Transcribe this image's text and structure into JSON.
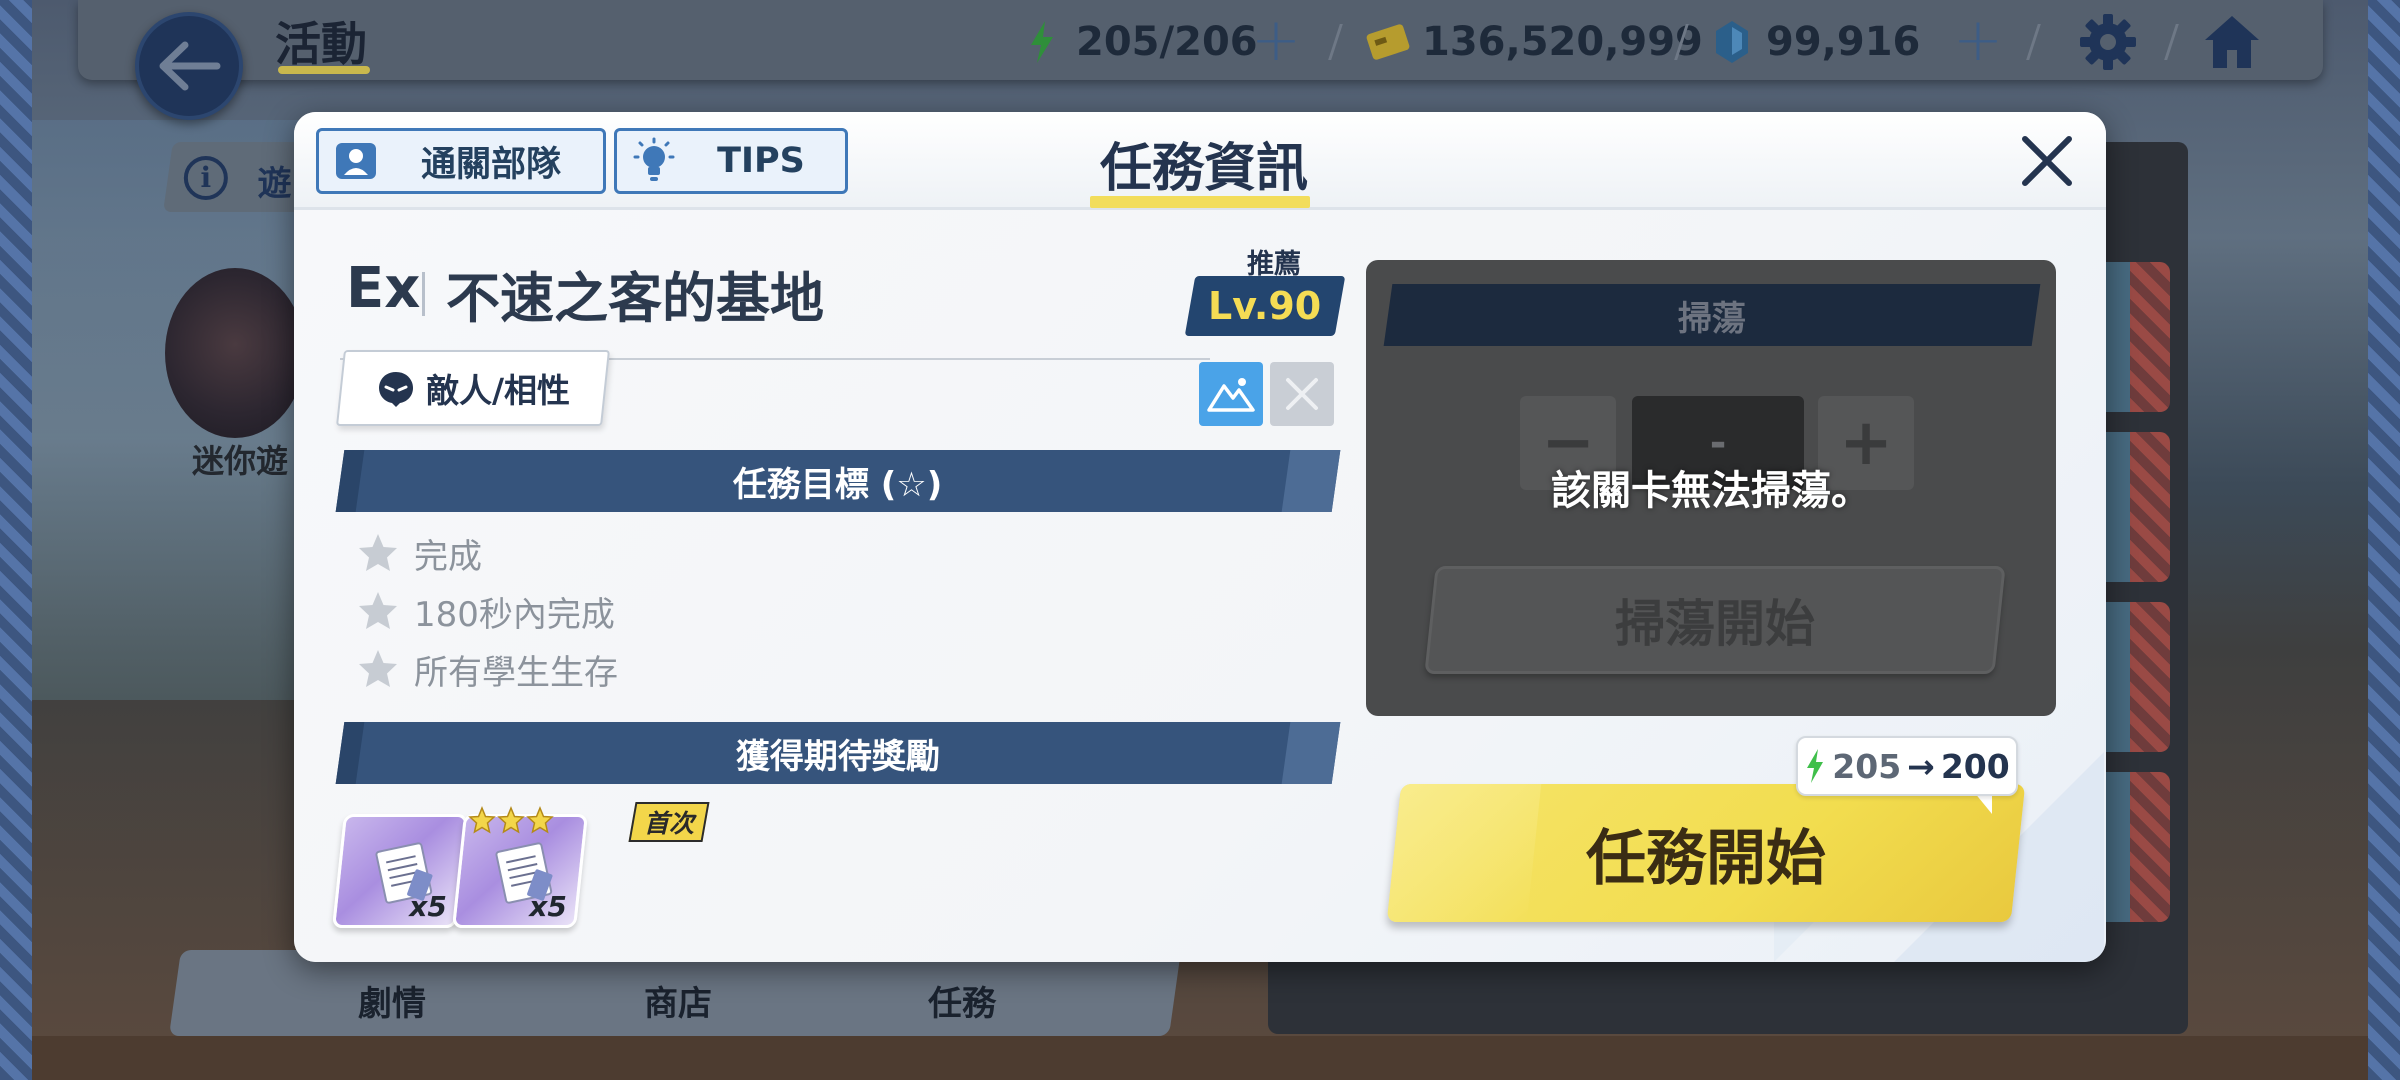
{
  "topbar": {
    "title": "活動",
    "stamina": "205/206",
    "credits": "136,520,999",
    "gems": "99,916"
  },
  "background": {
    "info_text": "遊",
    "mini_game_label": "迷你遊",
    "tabs": [
      "劇情",
      "商店",
      "任務"
    ]
  },
  "modal": {
    "title": "任務資訊",
    "header_buttons": {
      "clear_team": "通關部隊",
      "tips": "TIPS"
    },
    "stage": {
      "difficulty": "Ex",
      "name": "不速之客的基地",
      "recommend_label": "推薦",
      "recommend_level": "Lv.90"
    },
    "enemy_button": "敵人/相性",
    "objectives": {
      "header": "任務目標 (☆)",
      "items": [
        "完成",
        "180秒內完成",
        "所有學生生存"
      ]
    },
    "rewards": {
      "header": "獲得期待獎勵",
      "first_clear_tag": "首次",
      "items": [
        {
          "qty": "x5"
        },
        {
          "qty": "x5"
        }
      ]
    },
    "sweep": {
      "title": "掃蕩",
      "minus": "−",
      "value": "-",
      "plus": "+",
      "message": "該關卡無法掃蕩。",
      "start_label": "掃蕩開始"
    },
    "start": {
      "label": "任務開始",
      "cost_from": "205",
      "cost_arrow": "→",
      "cost_to": "200"
    }
  },
  "colors": {
    "accent_yellow": "#f2dd5b",
    "navy": "#36547c",
    "stamina_green": "#3fbf4a"
  }
}
